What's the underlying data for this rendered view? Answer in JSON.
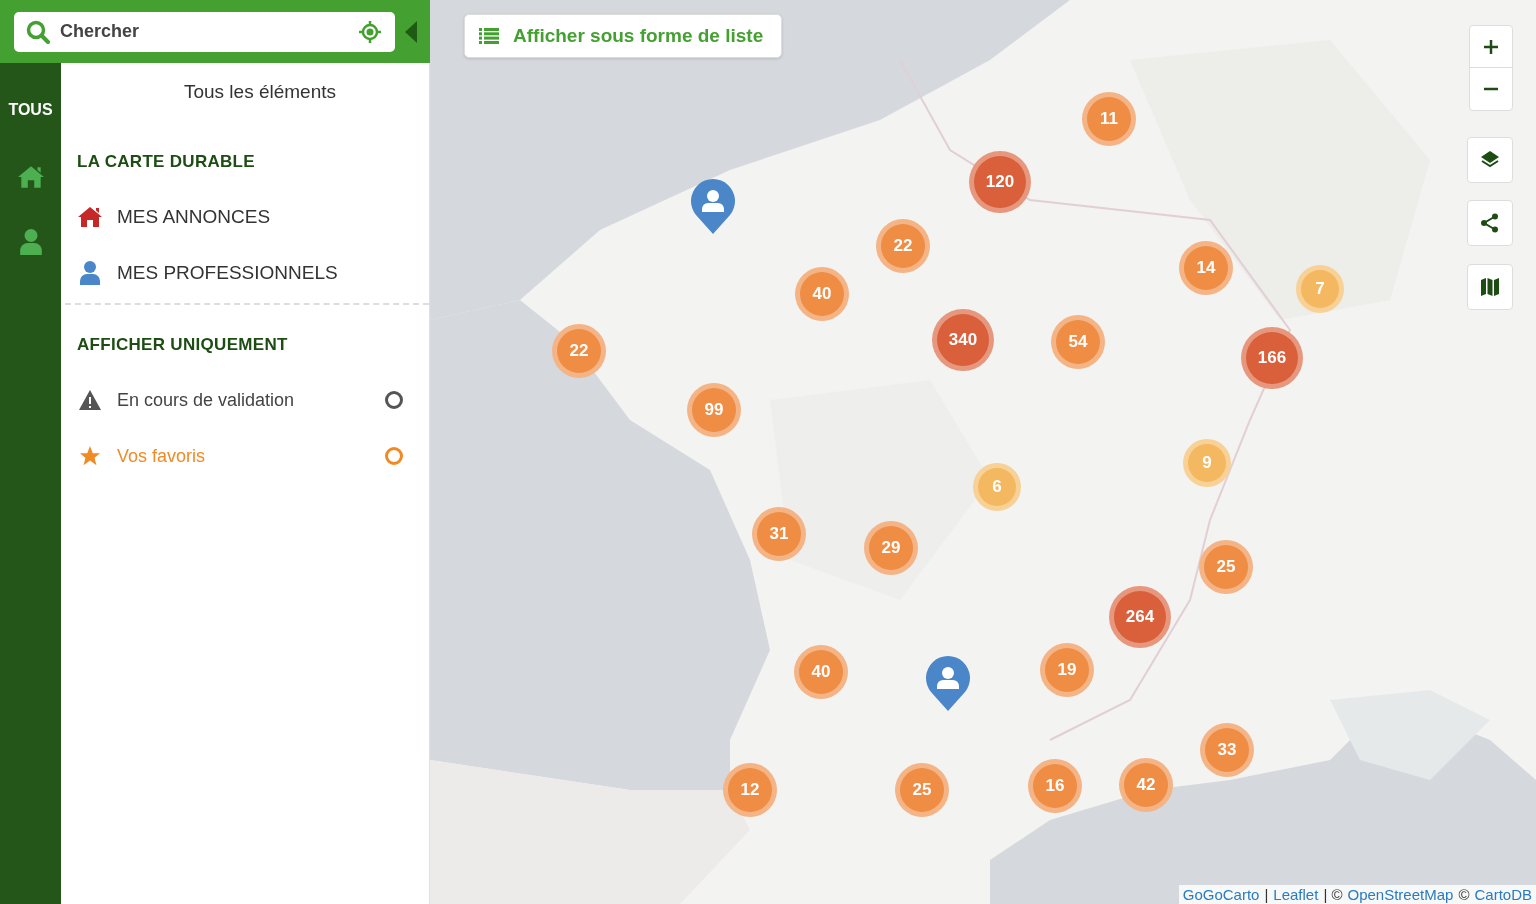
{
  "search": {
    "placeholder": "Chercher"
  },
  "rail": {
    "label": "TOUS"
  },
  "panel": {
    "title": "Tous les éléments",
    "categories": {
      "heading": "LA CARTE DURABLE",
      "items": [
        {
          "kind": "home",
          "label": "MES ANNONCES",
          "color": "#c62828"
        },
        {
          "kind": "user",
          "label": "MES PROFESSIONNELS",
          "color": "#4a86c8"
        }
      ]
    },
    "filters": {
      "heading": "AFFICHER UNIQUEMENT",
      "items": [
        {
          "kind": "warning",
          "label": "En cours de validation",
          "color": "#555555",
          "checked": false
        },
        {
          "kind": "star",
          "label": "Vos favoris",
          "color": "#f08a24",
          "checked": false
        }
      ]
    }
  },
  "list_button": {
    "label": "Afficher sous forme de liste"
  },
  "clusters": [
    {
      "count": "11",
      "color": "#ef8d45"
    },
    {
      "count": "120",
      "color": "#d9603a"
    },
    {
      "count": "22",
      "color": "#ef8d45"
    },
    {
      "count": "40",
      "color": "#ef8d45"
    },
    {
      "count": "14",
      "color": "#ef8d45"
    },
    {
      "count": "7",
      "color": "#f4b860"
    },
    {
      "count": "22",
      "color": "#ef8d45"
    },
    {
      "count": "340",
      "color": "#d9603a"
    },
    {
      "count": "54",
      "color": "#ef8d45"
    },
    {
      "count": "166",
      "color": "#d9603a"
    },
    {
      "count": "99",
      "color": "#ef8d45"
    },
    {
      "count": "9",
      "color": "#f4b860"
    },
    {
      "count": "6",
      "color": "#f4b860"
    },
    {
      "count": "31",
      "color": "#ef8d45"
    },
    {
      "count": "29",
      "color": "#ef8d45"
    },
    {
      "count": "25",
      "color": "#ef8d45"
    },
    {
      "count": "264",
      "color": "#d9603a"
    },
    {
      "count": "40",
      "color": "#ef8d45"
    },
    {
      "count": "19",
      "color": "#ef8d45"
    },
    {
      "count": "33",
      "color": "#ef8d45"
    },
    {
      "count": "12",
      "color": "#ef8d45"
    },
    {
      "count": "25",
      "color": "#ef8d45"
    },
    {
      "count": "16",
      "color": "#ef8d45"
    },
    {
      "count": "42",
      "color": "#ef8d45"
    }
  ],
  "markers": [
    {
      "kind": "user",
      "color": "#4a86c8"
    },
    {
      "kind": "user",
      "color": "#4a86c8"
    }
  ],
  "attribution": [
    {
      "kind": "link",
      "text": "GoGoCarto"
    },
    {
      "kind": "sep",
      "text": "|"
    },
    {
      "kind": "link",
      "text": "Leaflet"
    },
    {
      "kind": "sep",
      "text": "| ©"
    },
    {
      "kind": "link",
      "text": "OpenStreetMap"
    },
    {
      "kind": "sep",
      "text": "©"
    },
    {
      "kind": "link",
      "text": "CartoDB"
    }
  ]
}
